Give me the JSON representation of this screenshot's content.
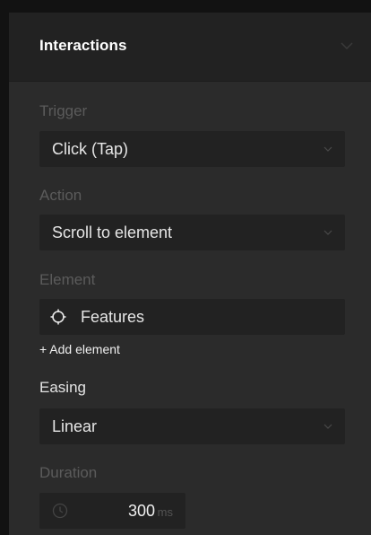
{
  "panel": {
    "title": "Interactions",
    "header_icon": "chevron-down-icon"
  },
  "trigger": {
    "label": "Trigger",
    "value": "Click (Tap)"
  },
  "action": {
    "label": "Action",
    "value": "Scroll to element"
  },
  "element": {
    "label": "Element",
    "value": "Features",
    "icon": "crosshair-target-icon",
    "add_label": "+ Add element"
  },
  "easing": {
    "label": "Easing",
    "value": "Linear"
  },
  "duration": {
    "label": "Duration",
    "value": "300",
    "unit": "ms",
    "icon": "clock-icon"
  },
  "colors": {
    "panel_bg": "#2b2b2b",
    "header_bg": "#222222",
    "field_bg": "#222222",
    "muted_label": "#5b5b5b",
    "text": "#e6e6e6"
  }
}
